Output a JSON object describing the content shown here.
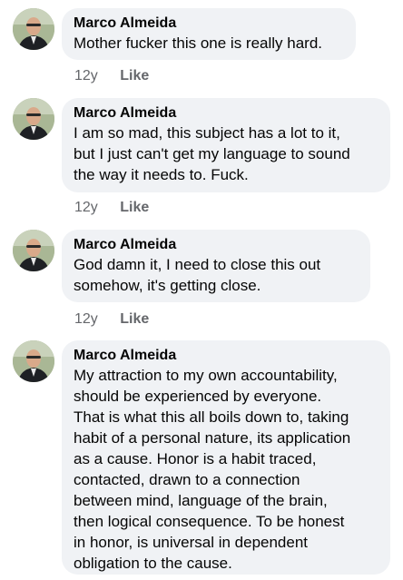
{
  "comments": [
    {
      "author": "Marco Almeida",
      "text": "Mother fucker this one is really hard.",
      "age": "12y",
      "like_label": "Like"
    },
    {
      "author": "Marco Almeida",
      "text": "I am so mad, this subject has a lot to it,\nbut I just can't get my language to sound\nthe way it needs to.  Fuck.",
      "age": "12y",
      "like_label": "Like"
    },
    {
      "author": "Marco Almeida",
      "text": "God damn it, I need to close this out\nsomehow, it's getting close.",
      "age": "12y",
      "like_label": "Like"
    },
    {
      "author": "Marco Almeida",
      "text": "My attraction to my own accountability,\nshould be experienced by everyone.\nThat is what this all boils down to, taking\nhabit of a personal nature, its application\nas a cause.  Honor is a habit traced,\ncontacted, drawn to a connection\nbetween mind, language of the brain,\nthen logical consequence.  To be honest\nin honor, is universal in dependent\nobligation to the cause."
    }
  ]
}
